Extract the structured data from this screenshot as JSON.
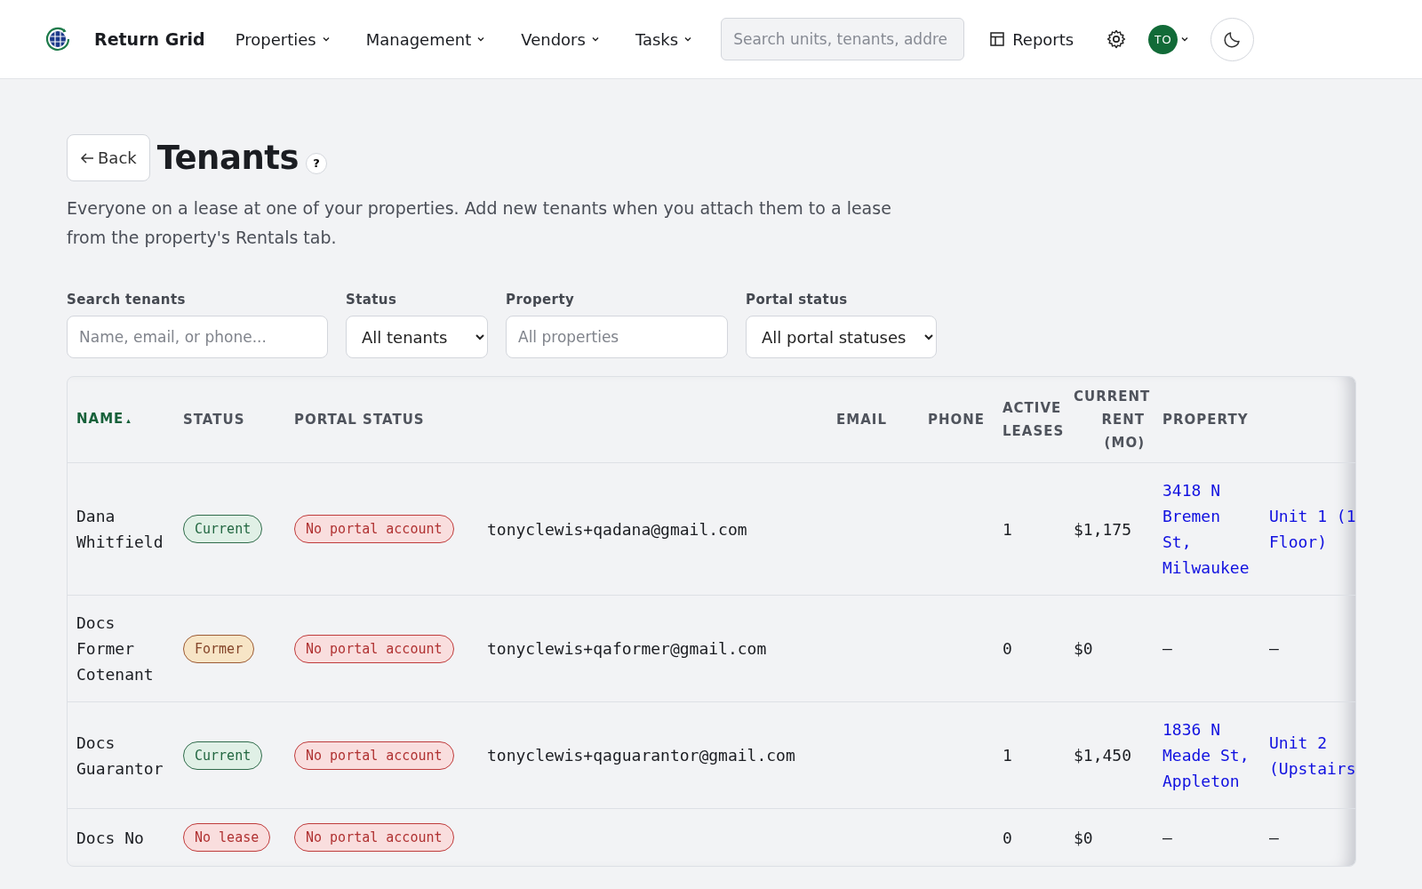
{
  "nav": {
    "brand": "Return Grid",
    "menus": [
      {
        "label": "Properties"
      },
      {
        "label": "Management"
      },
      {
        "label": "Vendors"
      },
      {
        "label": "Tasks"
      }
    ],
    "search": {
      "placeholder": "Search units, tenants, addre"
    },
    "reports": "Reports",
    "avatar": "TO"
  },
  "page": {
    "back": "Back",
    "title": "Tenants",
    "help": "?",
    "description": "Everyone on a lease at one of your properties. Add new tenants when you attach them to a lease from the property's Rentals tab."
  },
  "filters": [
    {
      "label": "Search tenants",
      "kind": "text",
      "placeholder": "Name, email, or phone..."
    },
    {
      "label": "Status",
      "kind": "select",
      "value": "All tenants"
    },
    {
      "label": "Property",
      "kind": "text",
      "placeholder": "All properties"
    },
    {
      "label": "Portal status",
      "kind": "select",
      "value": "All portal statuses"
    }
  ],
  "table": {
    "columns": [
      {
        "label": "NAME",
        "sorted": true,
        "sort_mark": "▴"
      },
      {
        "label": "STATUS",
        "sorted": false
      },
      {
        "label": "PORTAL STATUS",
        "sorted": false
      },
      {
        "label": "EMAIL",
        "sorted": false
      },
      {
        "label": "PHONE",
        "sorted": false
      },
      {
        "label": "ACTIVE LEASES",
        "sorted": false
      },
      {
        "label": "CURRENT RENT (MO)",
        "sorted": false
      },
      {
        "label": "PROPERTY",
        "sorted": false
      }
    ],
    "rows": [
      {
        "name": "Dana Whitfield",
        "status": {
          "label": "Current",
          "kind": "current"
        },
        "portal": {
          "label": "No portal account",
          "kind": "none"
        },
        "email": "tonyclewis+qadana@gmail.com",
        "active_leases": "1",
        "rent": "$1,175",
        "property": {
          "text": "3418 N Bremen St, Milwaukee",
          "link": true
        },
        "unit": {
          "lines": [
            "Unit 1 (1",
            "Floor)"
          ],
          "link": true
        }
      },
      {
        "name": "Docs Former Cotenant",
        "status": {
          "label": "Former",
          "kind": "former"
        },
        "portal": {
          "label": "No portal account",
          "kind": "none"
        },
        "email": "tonyclewis+qaformer@gmail.com",
        "active_leases": "0",
        "rent": "$0",
        "property": {
          "text": "—",
          "link": false
        },
        "unit": {
          "lines": [
            "—"
          ],
          "link": false
        }
      },
      {
        "name": "Docs Guarantor",
        "status": {
          "label": "Current",
          "kind": "current"
        },
        "portal": {
          "label": "No portal account",
          "kind": "none"
        },
        "email": "tonyclewis+qaguarantor@gmail.com",
        "active_leases": "1",
        "rent": "$1,450",
        "property": {
          "text": "1836 N Meade St, Appleton",
          "link": true
        },
        "unit": {
          "lines": [
            "Unit 2",
            "(Upstairs"
          ],
          "link": true
        }
      },
      {
        "name": "Docs No",
        "status": {
          "label": "No lease",
          "kind": "none"
        },
        "portal": {
          "label": "No portal account",
          "kind": "none"
        },
        "email": "",
        "active_leases": "0",
        "rent": "$0",
        "property": {
          "text": "—",
          "link": false
        },
        "unit": {
          "lines": [
            "—"
          ],
          "link": false
        }
      }
    ]
  }
}
